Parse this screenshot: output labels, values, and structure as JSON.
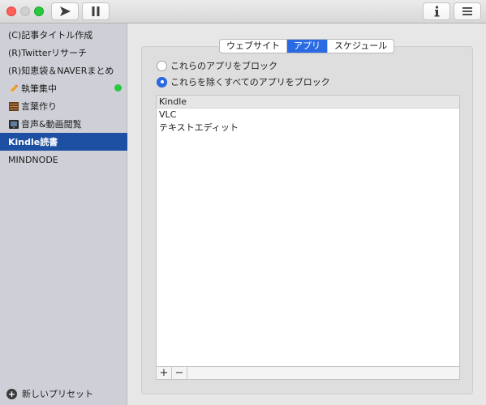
{
  "toolbar": {
    "play_icon": "play-icon",
    "pause_icon": "pause-icon",
    "info_icon": "info-icon",
    "menu_icon": "menu-icon"
  },
  "sidebar": {
    "items": [
      {
        "label": "(C)記事タイトル作成"
      },
      {
        "label": "(R)Twitterリサーチ"
      },
      {
        "label": "(R)知恵袋＆NAVERまとめ"
      },
      {
        "label": "執筆集中",
        "icon": "pencil-icon",
        "active": true
      },
      {
        "label": "言葉作り",
        "icon": "book-icon"
      },
      {
        "label": "音声&動画閲覧",
        "icon": "film-icon"
      },
      {
        "label": "Kindle読書",
        "selected": true
      },
      {
        "label": "MINDNODE"
      }
    ],
    "add_preset_label": "新しいプリセット"
  },
  "tabs": [
    {
      "label": "ウェブサイト"
    },
    {
      "label": "アプリ",
      "active": true
    },
    {
      "label": "スケジュール"
    }
  ],
  "options": {
    "block_listed": "これらのアプリをブロック",
    "block_all_except": "これらを除くすべてのアプリをブロック",
    "selected": "block_all_except"
  },
  "app_list": {
    "items": [
      "Kindle",
      "VLC",
      "テキストエディット"
    ],
    "add_label": "+",
    "remove_label": "−"
  },
  "colors": {
    "accent": "#2a6ae4",
    "sidebar_selected": "#1d4fa3",
    "status_green": "#28c840"
  }
}
